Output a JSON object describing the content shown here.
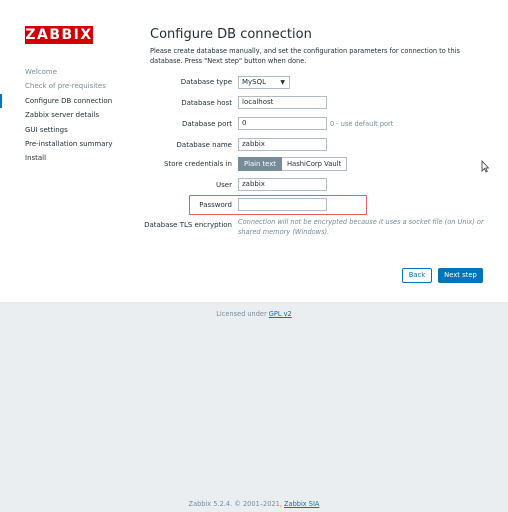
{
  "logo": "ZABBIX",
  "steps": [
    {
      "label": "Welcome",
      "state": "done"
    },
    {
      "label": "Check of pre-requisites",
      "state": "done"
    },
    {
      "label": "Configure DB connection",
      "state": "current"
    },
    {
      "label": "Zabbix server details",
      "state": "todo"
    },
    {
      "label": "GUI settings",
      "state": "todo"
    },
    {
      "label": "Pre-installation summary",
      "state": "todo"
    },
    {
      "label": "Install",
      "state": "todo"
    }
  ],
  "page": {
    "title": "Configure DB connection",
    "intro": "Please create database manually, and set the configuration parameters for connection to this database. Press \"Next step\" button when done."
  },
  "form": {
    "db_type_label": "Database type",
    "db_type_value": "MySQL",
    "db_host_label": "Database host",
    "db_host_value": "localhost",
    "db_port_label": "Database port",
    "db_port_value": "0",
    "db_port_hint": "0 - use default port",
    "db_name_label": "Database name",
    "db_name_value": "zabbix",
    "creds_label": "Store credentials in",
    "creds_options": [
      "Plain text",
      "HashiCorp Vault"
    ],
    "creds_selected": "Plain text",
    "user_label": "User",
    "user_value": "zabbix",
    "password_label": "Password",
    "password_value": "",
    "tls_label": "Database TLS encryption",
    "tls_note": "Connection will not be encrypted because it uses a socket file (on Unix) or shared memory (Windows)."
  },
  "buttons": {
    "back": "Back",
    "next": "Next step"
  },
  "license": {
    "prefix": "Licensed under",
    "link": "GPL v2"
  },
  "footer": {
    "text": "Zabbix 5.2.4. © 2001–2021,",
    "link": "Zabbix SIA"
  },
  "colors": {
    "brand": "#d40000",
    "accent": "#0275b8",
    "highlight": "#e06060"
  }
}
